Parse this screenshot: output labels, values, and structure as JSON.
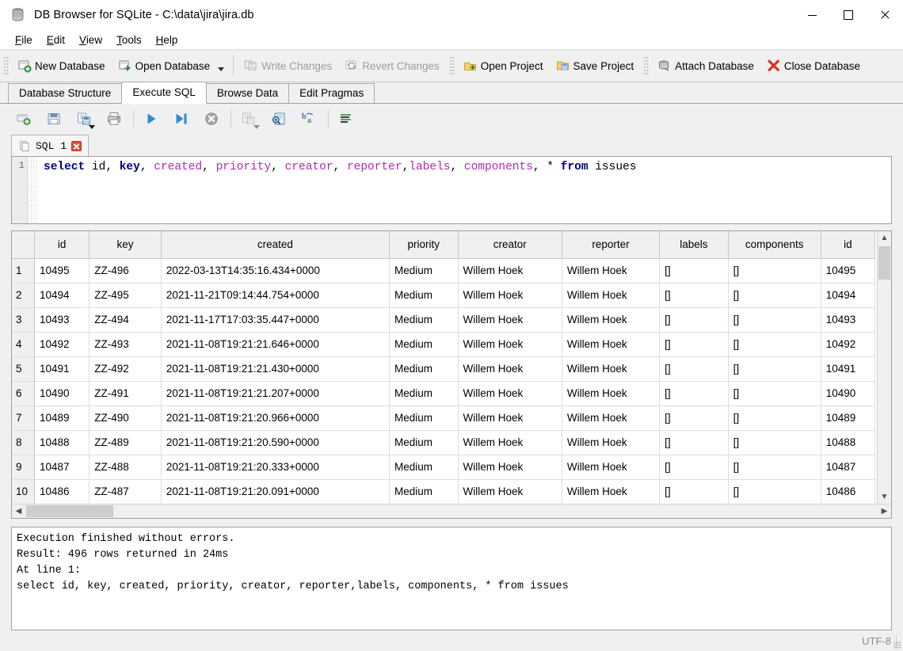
{
  "window": {
    "title": "DB Browser for SQLite - C:\\data\\jira\\jira.db",
    "icon": "database-icon",
    "minimize": "minimize-icon",
    "maximize": "maximize-icon",
    "close": "close-icon"
  },
  "menubar": [
    {
      "label": "File",
      "mnemonic": "F"
    },
    {
      "label": "Edit",
      "mnemonic": "E"
    },
    {
      "label": "View",
      "mnemonic": "V"
    },
    {
      "label": "Tools",
      "mnemonic": "T"
    },
    {
      "label": "Help",
      "mnemonic": "H"
    }
  ],
  "toolbar": [
    {
      "label": "New Database",
      "icon": "new-database-icon",
      "disabled": false
    },
    {
      "label": "Open Database",
      "icon": "open-database-icon",
      "disabled": false,
      "has_dropdown": true
    },
    {
      "label": "Write Changes",
      "icon": "write-changes-icon",
      "disabled": true
    },
    {
      "label": "Revert Changes",
      "icon": "revert-changes-icon",
      "disabled": true
    },
    {
      "label": "Open Project",
      "icon": "open-project-icon",
      "disabled": false
    },
    {
      "label": "Save Project",
      "icon": "save-project-icon",
      "disabled": false
    },
    {
      "label": "Attach Database",
      "icon": "attach-database-icon",
      "disabled": false
    },
    {
      "label": "Close Database",
      "icon": "close-database-icon",
      "disabled": false
    }
  ],
  "main_tabs": [
    {
      "label": "Database Structure",
      "active": false
    },
    {
      "label": "Execute SQL",
      "active": true
    },
    {
      "label": "Browse Data",
      "active": false
    },
    {
      "label": "Edit Pragmas",
      "active": false
    }
  ],
  "sql_toolbar": [
    {
      "icon": "open-new-tab-icon"
    },
    {
      "icon": "open-sql-file-icon"
    },
    {
      "icon": "save-sql-file-icon",
      "has_dropdown": true
    },
    {
      "icon": "print-icon"
    },
    {
      "icon": "execute-all-icon"
    },
    {
      "icon": "execute-current-line-icon"
    },
    {
      "icon": "stop-icon"
    },
    {
      "icon": "save-results-icon",
      "has_dropdown": true,
      "disabled": true
    },
    {
      "icon": "find-icon"
    },
    {
      "icon": "find-replace-icon"
    },
    {
      "icon": "format-sql-icon"
    }
  ],
  "sql_tab": {
    "label": "SQL 1",
    "icon": "sql-document-icon",
    "close_icon": "close-tab-icon"
  },
  "editor": {
    "line_number": "1",
    "tokens": [
      {
        "t": "select",
        "k": "kw"
      },
      {
        "t": " ",
        "k": "pl"
      },
      {
        "t": "id",
        "k": "pl"
      },
      {
        "t": ", ",
        "k": "pl"
      },
      {
        "t": "key",
        "k": "kw"
      },
      {
        "t": ", ",
        "k": "pl"
      },
      {
        "t": "created",
        "k": "idf"
      },
      {
        "t": ", ",
        "k": "pl"
      },
      {
        "t": "priority",
        "k": "idf"
      },
      {
        "t": ", ",
        "k": "pl"
      },
      {
        "t": "creator",
        "k": "idf"
      },
      {
        "t": ", ",
        "k": "pl"
      },
      {
        "t": "reporter",
        "k": "idf"
      },
      {
        "t": ",",
        "k": "pl"
      },
      {
        "t": "labels",
        "k": "idf"
      },
      {
        "t": ", ",
        "k": "pl"
      },
      {
        "t": "components",
        "k": "idf"
      },
      {
        "t": ", * ",
        "k": "pl"
      },
      {
        "t": "from",
        "k": "kw"
      },
      {
        "t": " issues",
        "k": "pl"
      }
    ],
    "plain_text": "select id, key, created, priority, creator, reporter,labels, components, * from issues"
  },
  "results": {
    "columns": [
      "id",
      "key",
      "created",
      "priority",
      "creator",
      "reporter",
      "labels",
      "components",
      "id"
    ],
    "rows": [
      {
        "n": "1",
        "cells": [
          "10495",
          "ZZ-496",
          "2022-03-13T14:35:16.434+0000",
          "Medium",
          "Willem Hoek",
          "Willem Hoek",
          "[]",
          "[]",
          "10495"
        ]
      },
      {
        "n": "2",
        "cells": [
          "10494",
          "ZZ-495",
          "2021-11-21T09:14:44.754+0000",
          "Medium",
          "Willem Hoek",
          "Willem Hoek",
          "[]",
          "[]",
          "10494"
        ]
      },
      {
        "n": "3",
        "cells": [
          "10493",
          "ZZ-494",
          "2021-11-17T17:03:35.447+0000",
          "Medium",
          "Willem Hoek",
          "Willem Hoek",
          "[]",
          "[]",
          "10493"
        ]
      },
      {
        "n": "4",
        "cells": [
          "10492",
          "ZZ-493",
          "2021-11-08T19:21:21.646+0000",
          "Medium",
          "Willem Hoek",
          "Willem Hoek",
          "[]",
          "[]",
          "10492"
        ]
      },
      {
        "n": "5",
        "cells": [
          "10491",
          "ZZ-492",
          "2021-11-08T19:21:21.430+0000",
          "Medium",
          "Willem Hoek",
          "Willem Hoek",
          "[]",
          "[]",
          "10491"
        ]
      },
      {
        "n": "6",
        "cells": [
          "10490",
          "ZZ-491",
          "2021-11-08T19:21:21.207+0000",
          "Medium",
          "Willem Hoek",
          "Willem Hoek",
          "[]",
          "[]",
          "10490"
        ]
      },
      {
        "n": "7",
        "cells": [
          "10489",
          "ZZ-490",
          "2021-11-08T19:21:20.966+0000",
          "Medium",
          "Willem Hoek",
          "Willem Hoek",
          "[]",
          "[]",
          "10489"
        ]
      },
      {
        "n": "8",
        "cells": [
          "10488",
          "ZZ-489",
          "2021-11-08T19:21:20.590+0000",
          "Medium",
          "Willem Hoek",
          "Willem Hoek",
          "[]",
          "[]",
          "10488"
        ]
      },
      {
        "n": "9",
        "cells": [
          "10487",
          "ZZ-488",
          "2021-11-08T19:21:20.333+0000",
          "Medium",
          "Willem Hoek",
          "Willem Hoek",
          "[]",
          "[]",
          "10487"
        ]
      },
      {
        "n": "10",
        "cells": [
          "10486",
          "ZZ-487",
          "2021-11-08T19:21:20.091+0000",
          "Medium",
          "Willem Hoek",
          "Willem Hoek",
          "[]",
          "[]",
          "10486"
        ]
      }
    ],
    "scroll_up_icon": "chevron-up-icon",
    "scroll_down_icon": "chevron-down-icon",
    "scroll_left_icon": "chevron-left-icon",
    "scroll_right_icon": "chevron-right-icon"
  },
  "log": "Execution finished without errors.\nResult: 496 rows returned in 24ms\nAt line 1:\nselect id, key, created, priority, creator, reporter,labels, components, * from issues",
  "statusbar": {
    "encoding": "UTF-8"
  },
  "colors": {
    "keyword": "#000080",
    "identifier": "#b02baf",
    "line_number": "#7c6f18",
    "close_db_x": "#d93025",
    "tab_close": "#e04a2f",
    "window_bg": "#f0f0f0"
  }
}
